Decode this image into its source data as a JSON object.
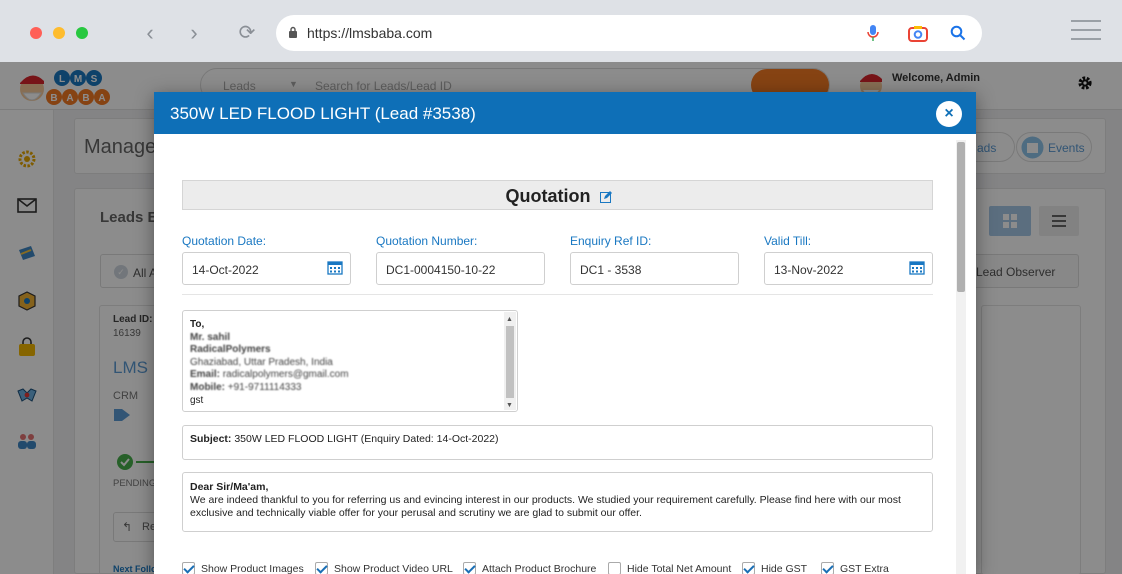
{
  "browser": {
    "url": "https://lmsbaba.com"
  },
  "app": {
    "logo_text": "LMS BABA",
    "search": {
      "category_placeholder": "Leads",
      "placeholder": "Search for Leads/Lead ID"
    },
    "welcome_text": "Welcome, Admin"
  },
  "background": {
    "page_title": "Manage",
    "events_button": "Events",
    "leads_button_partial": "ads",
    "section_title": "Leads B",
    "all_checkbox_label": "All A",
    "lead_observer_label": "Lead Observer",
    "lead_card": {
      "lead_id_label": "Lead ID:",
      "lead_id": "16139",
      "company_partial": "LMS",
      "category": "CRM",
      "status": "PENDING",
      "reply_partial": "Re",
      "next_followup_partial": "Next Follo"
    }
  },
  "modal": {
    "title": "350W LED FLOOD LIGHT (Lead #3538)",
    "close_symbol": "×",
    "heading": "Quotation",
    "fields": {
      "quotation_date": {
        "label": "Quotation Date:",
        "value": "14-Oct-2022"
      },
      "quotation_number": {
        "label": "Quotation Number:",
        "value": "DC1-0004150-10-22"
      },
      "enquiry_ref": {
        "label": "Enquiry Ref ID:",
        "value": "DC1 - 3538"
      },
      "valid_till": {
        "label": "Valid Till:",
        "value": "13-Nov-2022"
      }
    },
    "address": {
      "to": "To,",
      "name": "Mr. sahil",
      "company": "RadicalPolymers",
      "location": "Ghaziabad, Uttar Pradesh, India",
      "email_label": "Email:",
      "email": "radicalpolymers@gmail.com",
      "mobile_label": "Mobile:",
      "mobile": "+91-9711114333",
      "extra": "gst"
    },
    "subject": {
      "label": "Subject:",
      "text": "350W LED FLOOD LIGHT (Enquiry Dated: 14-Oct-2022)"
    },
    "letter": {
      "salutation": "Dear Sir/Ma'am,",
      "body": "We are indeed thankful to you for referring us and evincing interest in our products. We studied your requirement carefully. Please find here with our most exclusive and technically viable offer for your perusal and scrutiny we are glad to submit our offer."
    },
    "options": [
      {
        "label": "Show Product Images",
        "checked": true
      },
      {
        "label": "Show Product Video URL",
        "checked": true
      },
      {
        "label": "Attach Product Brochure",
        "checked": true
      },
      {
        "label": "Hide Total Net Amount",
        "checked": false
      },
      {
        "label": "Hide GST",
        "checked": true
      },
      {
        "label": "GST Extra",
        "checked": true
      }
    ]
  }
}
